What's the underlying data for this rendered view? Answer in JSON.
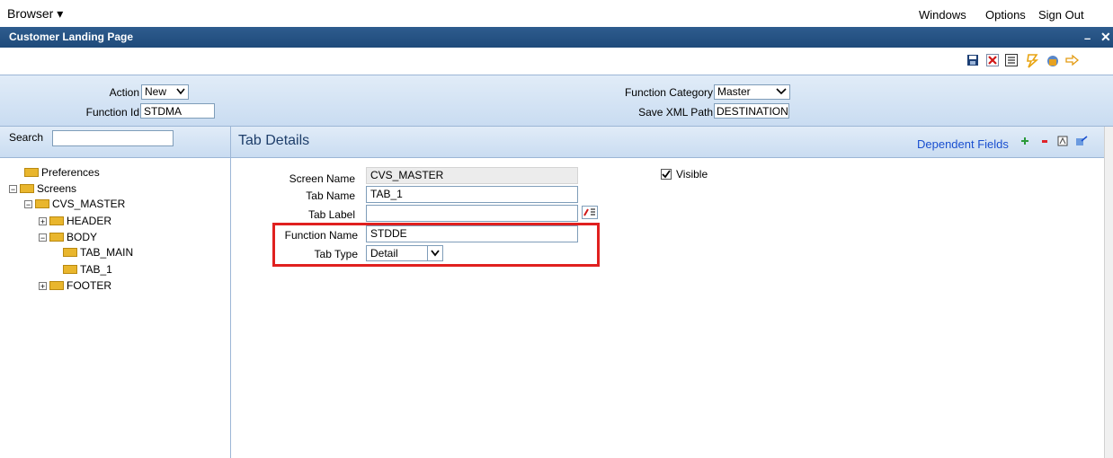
{
  "topbar": {
    "browser_label": "Browser ▾",
    "links": [
      "Windows",
      "Options",
      "Sign Out"
    ]
  },
  "window": {
    "title": "Customer Landing Page",
    "minimize_glyph": "–",
    "close_glyph": "✕"
  },
  "header": {
    "action_label": "Action",
    "action_value": "New",
    "function_id_label": "Function Id",
    "function_id_value": "STDMA",
    "function_category_label": "Function Category",
    "function_category_value": "Master",
    "save_xml_label": "Save XML Path",
    "save_xml_value": "DESTINATION"
  },
  "search": {
    "label": "Search",
    "value": ""
  },
  "tree": {
    "preferences": "Preferences",
    "screens": "Screens",
    "cvs_master": "CVS_MASTER",
    "header": "HEADER",
    "body": "BODY",
    "tab_main": "TAB_MAIN",
    "tab_1": "TAB_1",
    "footer": "FOOTER"
  },
  "panel": {
    "title": "Tab Details",
    "dependent_fields": "Dependent Fields"
  },
  "form": {
    "screen_name_label": "Screen Name",
    "screen_name_value": "CVS_MASTER",
    "tab_name_label": "Tab Name",
    "tab_name_value": "TAB_1",
    "tab_label_label": "Tab Label",
    "tab_label_value": "",
    "function_name_label": "Function Name",
    "function_name_value": "STDDE",
    "tab_type_label": "Tab Type",
    "tab_type_value": "Detail",
    "visible_label": "Visible",
    "visible_checked": true
  },
  "colors": {
    "title_bar": "#1f4a7a",
    "highlight_box": "#e0201f",
    "link_blue": "#1a4fcf"
  }
}
